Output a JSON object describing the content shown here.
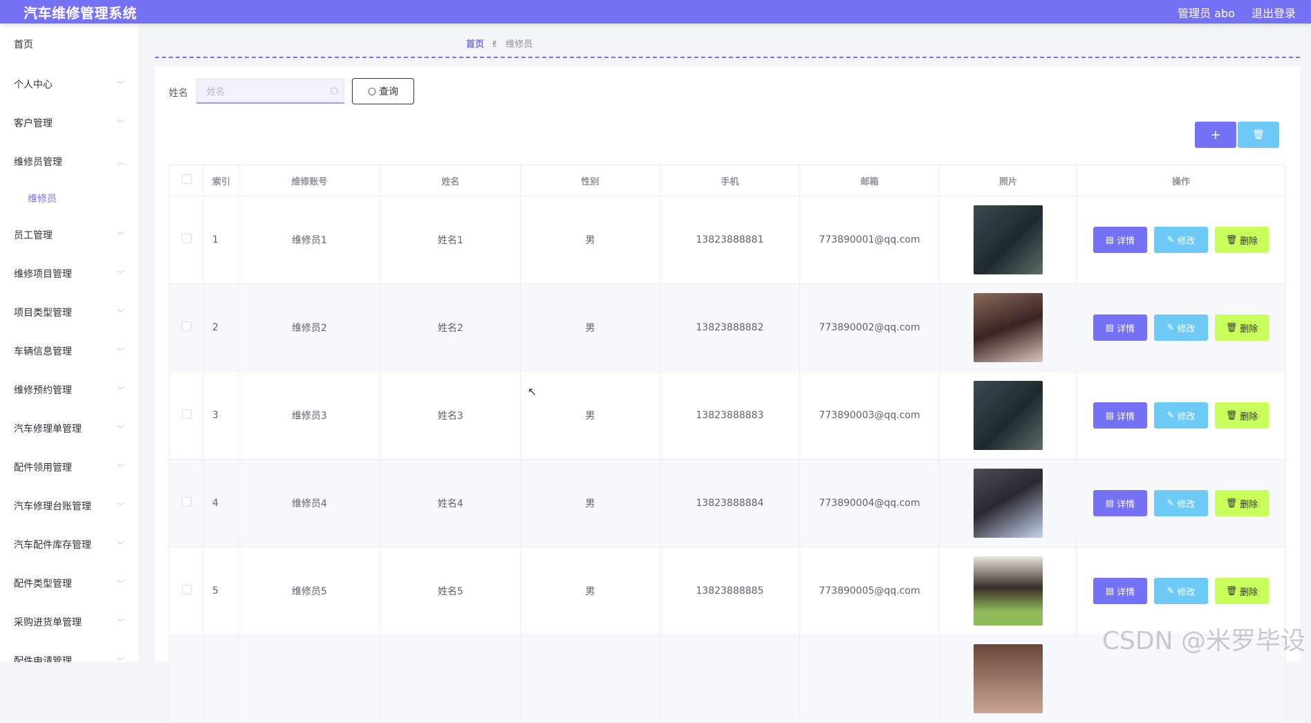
{
  "app": {
    "title": "汽车维修管理系统",
    "user": "管理员 abo",
    "logout": "退出登录",
    "accent_color": "#7471f5"
  },
  "sidebar": {
    "home": "首页",
    "items": [
      {
        "label": "个人中心",
        "state": "collapsed"
      },
      {
        "label": "客户管理",
        "state": "collapsed"
      },
      {
        "label": "维修员管理",
        "state": "expanded"
      },
      {
        "label": "员工管理",
        "state": "collapsed"
      },
      {
        "label": "维修项目管理",
        "state": "collapsed"
      },
      {
        "label": "项目类型管理",
        "state": "collapsed"
      },
      {
        "label": "车辆信息管理",
        "state": "collapsed"
      },
      {
        "label": "维修预约管理",
        "state": "collapsed"
      },
      {
        "label": "汽车修理单管理",
        "state": "collapsed"
      },
      {
        "label": "配件领用管理",
        "state": "collapsed"
      },
      {
        "label": "汽车修理台账管理",
        "state": "collapsed"
      },
      {
        "label": "汽车配件库存管理",
        "state": "collapsed"
      },
      {
        "label": "配件类型管理",
        "state": "collapsed"
      },
      {
        "label": "采购进货单管理",
        "state": "collapsed"
      },
      {
        "label": "配件申请管理",
        "state": "collapsed"
      }
    ],
    "subitem": "维修员"
  },
  "breadcrumb": {
    "home": "首页",
    "current": "维修员"
  },
  "search": {
    "label": "姓名",
    "placeholder": "姓名",
    "value": "",
    "button": "查询"
  },
  "toolbar": {
    "add": "+",
    "delete_icon": "trash-icon"
  },
  "table": {
    "headers": [
      "索引",
      "维修账号",
      "姓名",
      "性别",
      "手机",
      "邮箱",
      "照片",
      "操作"
    ],
    "rows": [
      {
        "index": "1",
        "account": "维修员1",
        "name": "姓名1",
        "gender": "男",
        "phone": "13823888881",
        "email": "773890001@qq.com"
      },
      {
        "index": "2",
        "account": "维修员2",
        "name": "姓名2",
        "gender": "男",
        "phone": "13823888882",
        "email": "773890002@qq.com"
      },
      {
        "index": "3",
        "account": "维修员3",
        "name": "姓名3",
        "gender": "男",
        "phone": "13823888883",
        "email": "773890003@qq.com"
      },
      {
        "index": "4",
        "account": "维修员4",
        "name": "姓名4",
        "gender": "男",
        "phone": "13823888884",
        "email": "773890004@qq.com"
      },
      {
        "index": "5",
        "account": "维修员5",
        "name": "姓名5",
        "gender": "男",
        "phone": "13823888885",
        "email": "773890005@qq.com"
      }
    ],
    "actions": {
      "detail": "详情",
      "edit": "修改",
      "delete": "删除"
    }
  },
  "watermark": "CSDN @米罗毕设"
}
